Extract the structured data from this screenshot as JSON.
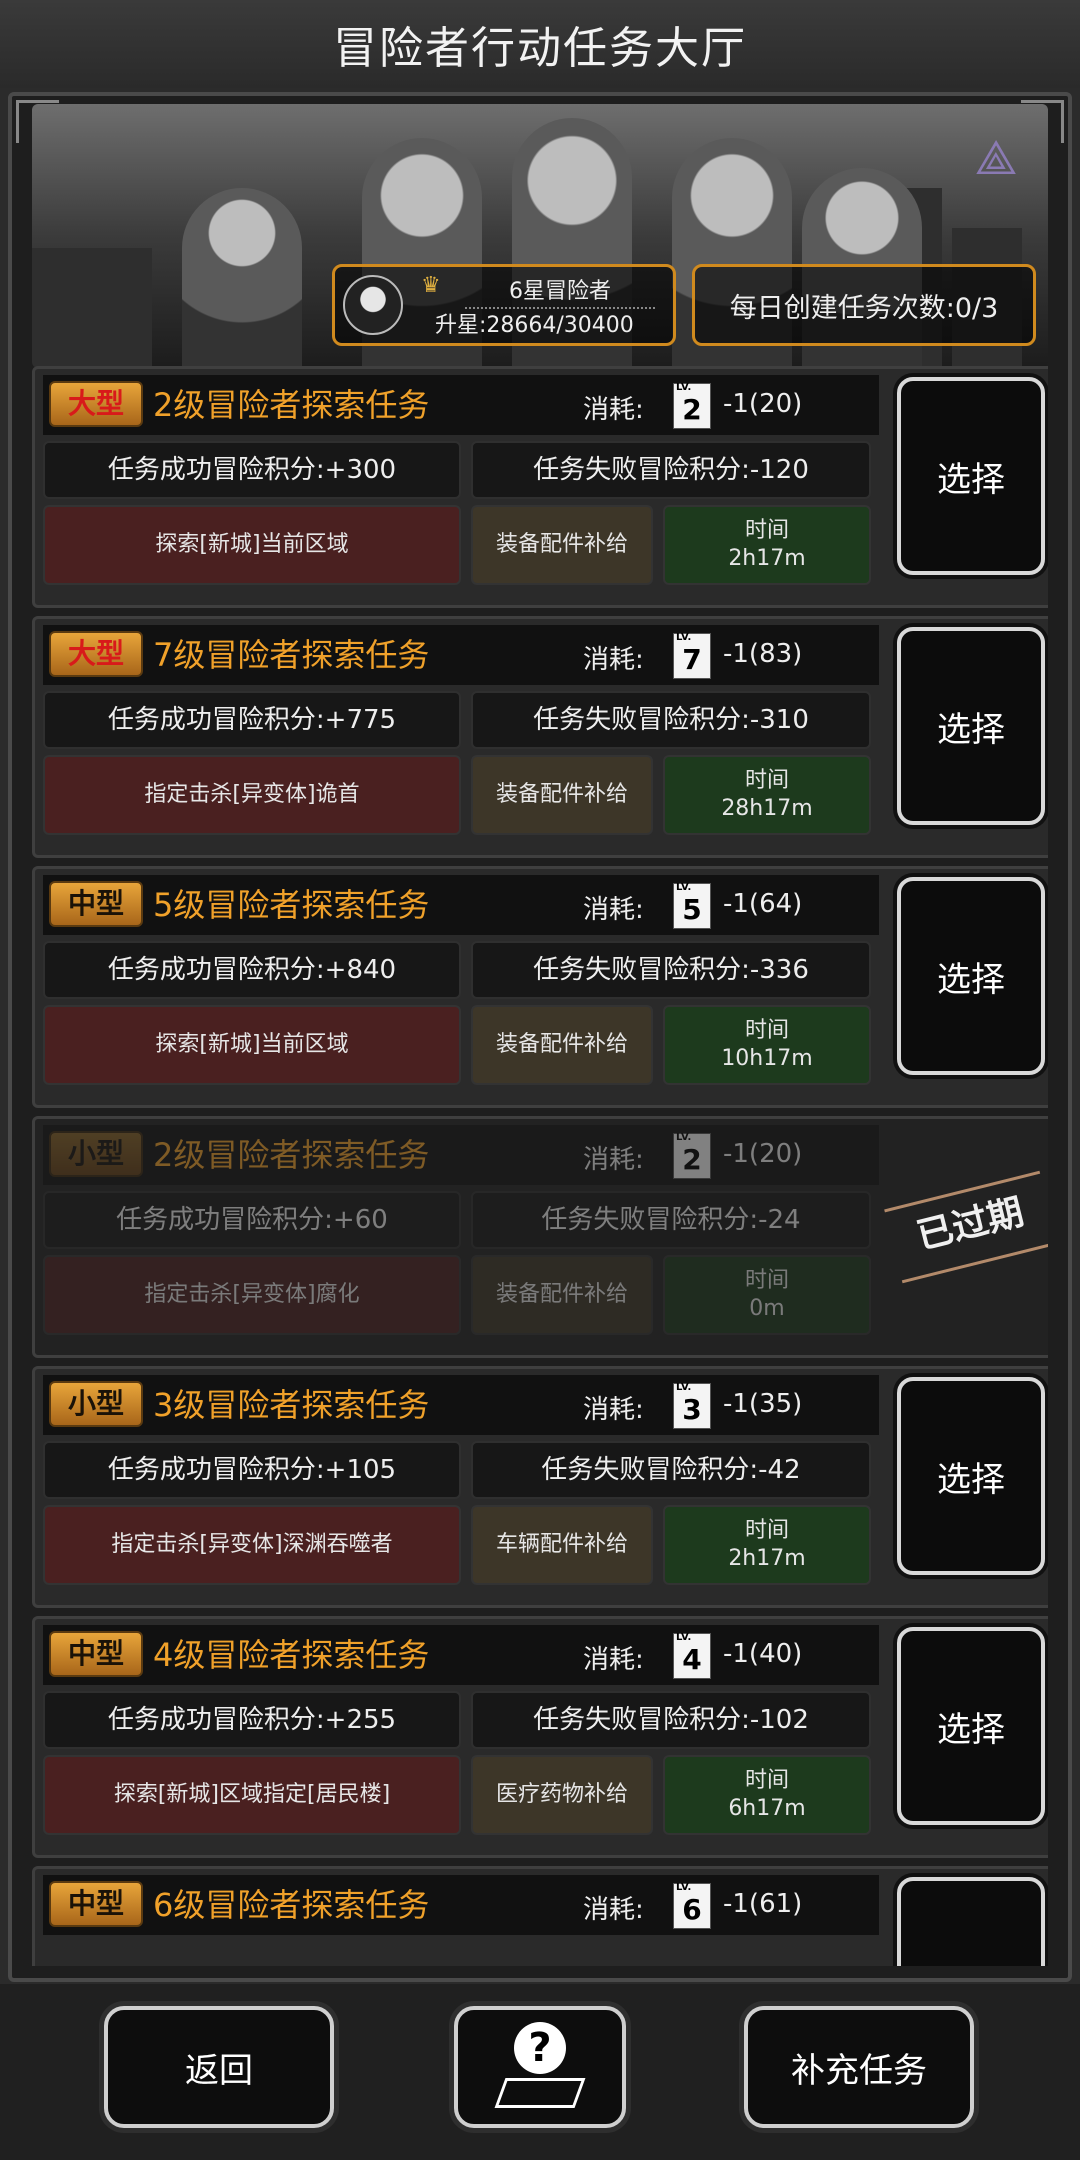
{
  "header": {
    "title": "冒险者行动任务大厅"
  },
  "banner": {
    "rank_title": "6星冒险者",
    "rank_exp": "升星:28664/30400",
    "daily_tasks": "每日创建任务次数:0/3"
  },
  "tasks": [
    {
      "type": "大型",
      "name": "2级冒险者探索任务",
      "cost_label": "消耗:",
      "lv": "2",
      "cost": "-1(20)",
      "success": "任务成功冒险积分:+300",
      "fail": "任务失败冒险积分:-120",
      "target": "探索[新城]当前区域",
      "supply": "装备配件补给",
      "time_label": "时间",
      "time": "2h17m",
      "action": "选择"
    },
    {
      "type": "大型",
      "name": "7级冒险者探索任务",
      "cost_label": "消耗:",
      "lv": "7",
      "cost": "-1(83)",
      "success": "任务成功冒险积分:+775",
      "fail": "任务失败冒险积分:-310",
      "target": "指定击杀[异变体]诡首",
      "supply": "装备配件补给",
      "time_label": "时间",
      "time": "28h17m",
      "action": "选择"
    },
    {
      "type": "中型",
      "name": "5级冒险者探索任务",
      "cost_label": "消耗:",
      "lv": "5",
      "cost": "-1(64)",
      "success": "任务成功冒险积分:+840",
      "fail": "任务失败冒险积分:-336",
      "target": "探索[新城]当前区域",
      "supply": "装备配件补给",
      "time_label": "时间",
      "time": "10h17m",
      "action": "选择"
    },
    {
      "type": "小型",
      "name": "2级冒险者探索任务",
      "cost_label": "消耗:",
      "lv": "2",
      "cost": "-1(20)",
      "success": "任务成功冒险积分:+60",
      "fail": "任务失败冒险积分:-24",
      "target": "指定击杀[异变体]腐化",
      "supply": "装备配件补给",
      "time_label": "时间",
      "time": "0m",
      "action": "已过期"
    },
    {
      "type": "小型",
      "name": "3级冒险者探索任务",
      "cost_label": "消耗:",
      "lv": "3",
      "cost": "-1(35)",
      "success": "任务成功冒险积分:+105",
      "fail": "任务失败冒险积分:-42",
      "target": "指定击杀[异变体]深渊吞噬者",
      "supply": "车辆配件补给",
      "time_label": "时间",
      "time": "2h17m",
      "action": "选择"
    },
    {
      "type": "中型",
      "name": "4级冒险者探索任务",
      "cost_label": "消耗:",
      "lv": "4",
      "cost": "-1(40)",
      "success": "任务成功冒险积分:+255",
      "fail": "任务失败冒险积分:-102",
      "target": "探索[新城]区域指定[居民楼]",
      "supply": "医疗药物补给",
      "time_label": "时间",
      "time": "6h17m",
      "action": "选择"
    },
    {
      "type": "中型",
      "name": "6级冒险者探索任务",
      "cost_label": "消耗:",
      "lv": "6",
      "cost": "-1(61)"
    }
  ],
  "footer": {
    "back": "返回",
    "help_icon": "help-question-map-icon",
    "refill": "补充任务"
  }
}
